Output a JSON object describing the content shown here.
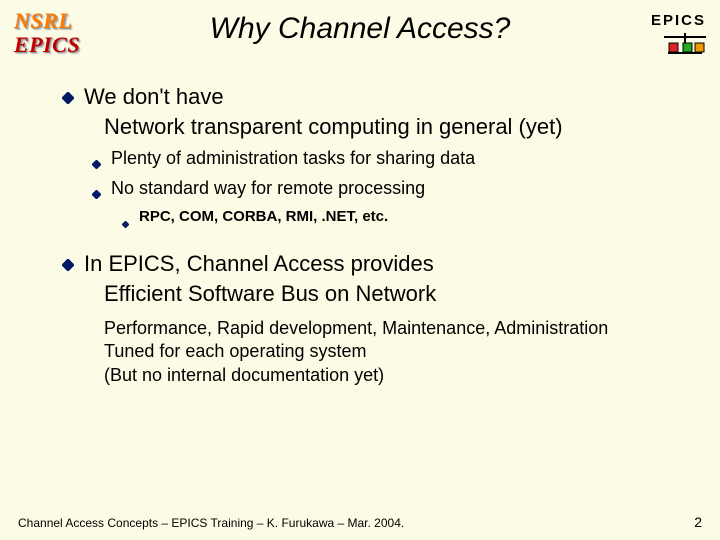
{
  "logos": {
    "nsrl": "NSRL",
    "epics_left": "EPICS",
    "epics_right": "EPICS"
  },
  "title": "Why Channel Access?",
  "b1": {
    "head": "We don't have",
    "sub": "Network transparent computing in general (yet)",
    "children": [
      "Plenty of administration tasks for sharing data",
      "No standard way for remote processing"
    ],
    "grand": "RPC, COM, CORBA, RMI, .NET, etc."
  },
  "b2": {
    "head": "In EPICS, Channel Access provides",
    "sub": "Efficient Software Bus on Network",
    "perf": [
      "Performance, Rapid development, Maintenance, Administration",
      "Tuned for each operating system",
      "(But no internal documentation yet)"
    ]
  },
  "footer": {
    "text": "Channel Access Concepts – EPICS Training – K. Furukawa – Mar. 2004.",
    "page": "2"
  }
}
